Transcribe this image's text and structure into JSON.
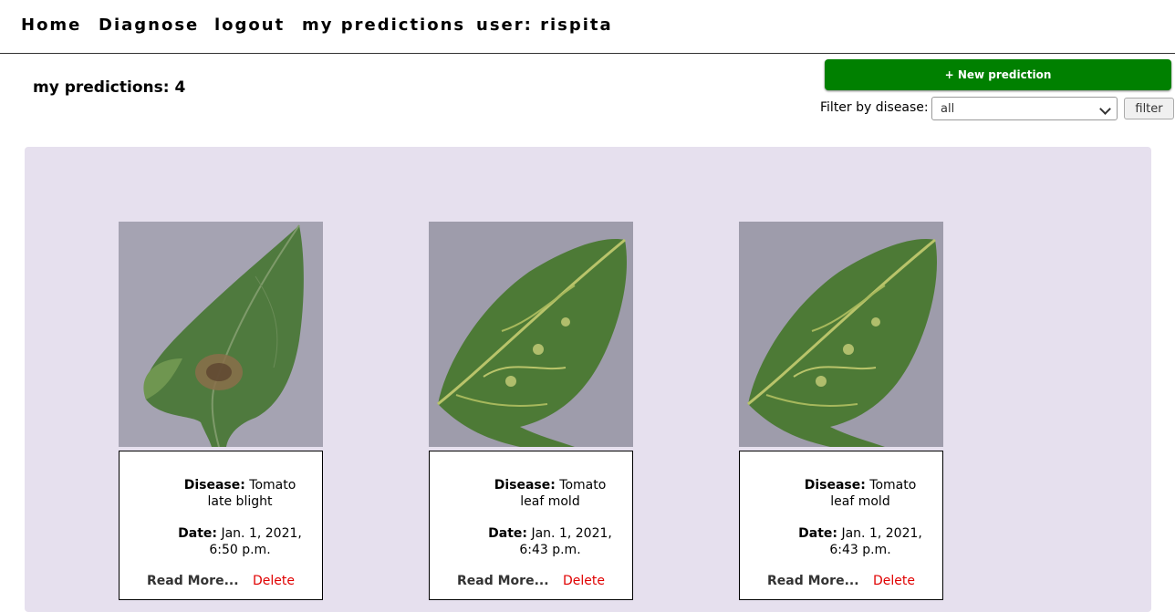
{
  "nav": {
    "home": "Home",
    "diagnose": "Diagnose",
    "logout": "logout",
    "my_predictions": "my predictions",
    "user": "user: rispita"
  },
  "page": {
    "heading": "my predictions: 4"
  },
  "actions": {
    "new_prediction": "+ New prediction",
    "filter_label": "Filter by disease:",
    "filter_value": "all",
    "filter_button": "filter"
  },
  "colors": {
    "accent_green": "#008000",
    "panel_bg": "#e6e0ee",
    "delete_red": "#e00000"
  },
  "predictions": [
    {
      "disease_label": "Disease:",
      "disease": "Tomato late blight",
      "date_label": "Date:",
      "date": "Jan. 1, 2021, 6:50 p.m.",
      "read_more": "Read More...",
      "delete": "Delete"
    },
    {
      "disease_label": "Disease:",
      "disease": "Tomato leaf mold",
      "date_label": "Date:",
      "date": "Jan. 1, 2021, 6:43 p.m.",
      "read_more": "Read More...",
      "delete": "Delete"
    },
    {
      "disease_label": "Disease:",
      "disease": "Tomato leaf mold",
      "date_label": "Date:",
      "date": "Jan. 1, 2021, 6:43 p.m.",
      "read_more": "Read More...",
      "delete": "Delete"
    }
  ]
}
